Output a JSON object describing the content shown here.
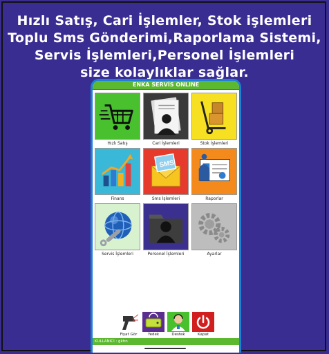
{
  "promo": {
    "line1": "Hızlı Satış, Cari İşlemler, Stok işlemleri",
    "line2": "Toplu Sms Gönderimi,Raporlama Sistemi,",
    "line3": "Servis İşlemleri,Personel İşlemleri",
    "line4": "size kolaylıklar sağlar."
  },
  "app": {
    "title": "ENKA SERVİS ONLINE",
    "tiles": [
      {
        "label": "Hızlı Satış",
        "icon": "shopping-cart-icon",
        "color": "#49c12e"
      },
      {
        "label": "Cari İşlemleri",
        "icon": "person-document-icon",
        "color": "#3a3a3a"
      },
      {
        "label": "Stok İşlemleri",
        "icon": "hand-truck-icon",
        "color": "#f7df22"
      },
      {
        "label": "Finans",
        "icon": "bar-chart-icon",
        "color": "#34b7d6"
      },
      {
        "label": "Sms İşlemleri",
        "icon": "sms-envelope-icon",
        "color": "#e63a2c"
      },
      {
        "label": "Raporlar",
        "icon": "report-screen-icon",
        "color": "#f48a1c"
      },
      {
        "label": "Servis İşlemleri",
        "icon": "globe-wrench-icon",
        "color": "#d8f2d0"
      },
      {
        "label": "Personel İşlemleri",
        "icon": "person-folder-icon",
        "color": "#3b2f8f"
      },
      {
        "label": "Ayarlar",
        "icon": "gears-icon",
        "color": "#bdbdbd"
      }
    ],
    "bottom": [
      {
        "label": "Fiyat Gör",
        "icon": "barcode-scanner-icon"
      },
      {
        "label": "Yedek",
        "icon": "backup-drive-icon"
      },
      {
        "label": "Destek",
        "icon": "support-agent-icon"
      },
      {
        "label": "Kapat",
        "icon": "power-icon"
      }
    ],
    "footer": "KULLANICI : gkhn"
  }
}
